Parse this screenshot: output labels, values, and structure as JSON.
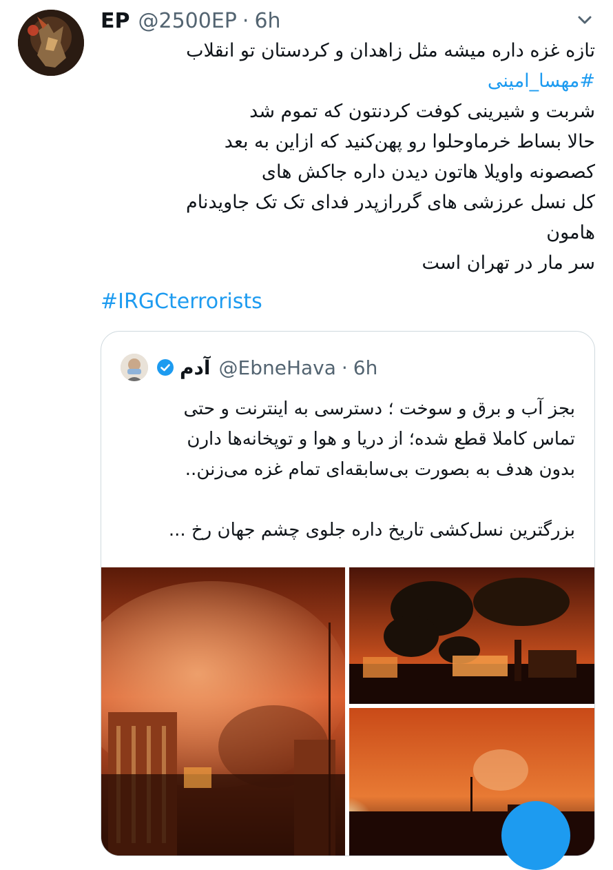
{
  "tweet": {
    "author_name": "EP",
    "handle": "@2500EP",
    "separator": "·",
    "time": "6h",
    "lines": [
      "تازه غزه داره میشه مثل زاهدان و کردستان تو انقلاب",
      "#مهسا_امینی",
      "شربت و شیرینی کوفت کردنتون که تموم شد",
      "حالا بساط خرماوحلوا رو پهن‌کنید که ازاین به بعد",
      "کصصونه واویلا هاتون دیدن داره جاکش های",
      "کل نسل عرزشی های گررازپدر فدای تک تک جاویدنام",
      "هامون",
      "سر مار در تهران است"
    ],
    "hashtag_en": "#IRGCterrorists"
  },
  "quote": {
    "name": "آدم",
    "handle": "@EbneHava",
    "separator": "·",
    "time": "6h",
    "lines": [
      "بجز آب و برق و سوخت ؛ دسترسی به اینترنت و حتی",
      "تماس کاملا قطع شده؛ از دریا و هوا و توپخانه‌ها دارن",
      "بدون هدف به بصورت بی‌سابقه‌ای تمام غزه می‌زنن..",
      "",
      "بزرگترین نسل‌کشی تاریخ داره جلوی چشم جهان رخ ..."
    ]
  },
  "colors": {
    "link": "#1d9bf0",
    "secondary_text": "#536471",
    "border": "#cfd9de",
    "verified": "#1d9bf0"
  },
  "icons": [
    "avatar",
    "more-chevron-icon",
    "verified-badge-icon",
    "compose-fab"
  ]
}
